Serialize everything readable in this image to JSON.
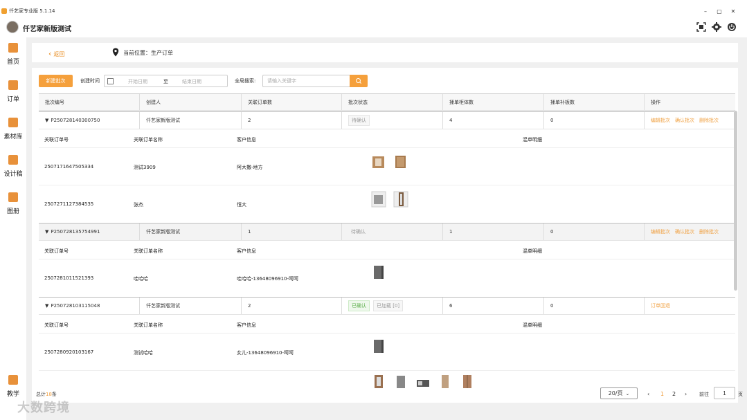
{
  "titlebar": {
    "app_title": "仟艺家专业版 5.1.14"
  },
  "header": {
    "user_name": "仟艺家新版测试"
  },
  "sidebar": {
    "items": [
      {
        "label": "首页",
        "icon": "home-icon"
      },
      {
        "label": "订单",
        "icon": "order-icon"
      },
      {
        "label": "素材库",
        "icon": "material-icon"
      },
      {
        "label": "设计稿",
        "icon": "design-icon"
      },
      {
        "label": "图册",
        "icon": "album-icon"
      }
    ],
    "bottom_item": {
      "label": "教学",
      "icon": "tutorial-icon"
    }
  },
  "breadcrumb": {
    "back": "返回",
    "location": "当前位置：生产订单"
  },
  "toolbar": {
    "new_batch": "新建批次",
    "created_time_label": "创建时间",
    "start_placeholder": "开始日期",
    "range_sep": "至",
    "end_placeholder": "结束日期",
    "search_label": "全局搜索:",
    "search_placeholder": "请输入关键字"
  },
  "table": {
    "columns": [
      "批次编号",
      "创建人",
      "关联订单数",
      "批次状态",
      "揉单柜体数",
      "揉单补板数",
      "操作"
    ],
    "sub_columns": [
      "关联订单号",
      "关联订单名称",
      "客户信息",
      "混单明细"
    ],
    "batches": [
      {
        "id": "P250728140300750",
        "creator": "仟艺家新版测试",
        "order_count": "2",
        "status": "待确认",
        "status2": "",
        "cabinet_count": "4",
        "board_count": "0",
        "actions": [
          "编辑批次",
          "确认批次",
          "删除批次"
        ],
        "orders": [
          {
            "no": "2507171647505334",
            "name": "测试3909",
            "customer": "阿大撒-地方"
          },
          {
            "no": "2507271127384535",
            "name": "张杰",
            "customer": "恒大"
          }
        ]
      },
      {
        "id": "P250728135754991",
        "creator": "仟艺家新版测试",
        "order_count": "1",
        "status": "待确认",
        "status2": "",
        "cabinet_count": "1",
        "board_count": "0",
        "actions": [
          "编辑批次",
          "确认批次",
          "删除批次"
        ],
        "orders": [
          {
            "no": "2507281011521393",
            "name": "哇哈哈",
            "customer": "哇哈哈-13648096910-呵呵"
          }
        ]
      },
      {
        "id": "P250728103115048",
        "creator": "仟艺家新版测试",
        "order_count": "2",
        "status": "已确认",
        "status2": "已加载 [0]",
        "cabinet_count": "6",
        "board_count": "0",
        "actions": [
          "订单回退"
        ],
        "orders": [
          {
            "no": "2507280920103167",
            "name": "测试哈哈",
            "customer": "女儿-13648096910-呵呵"
          }
        ]
      }
    ]
  },
  "footer": {
    "total_prefix": "总计",
    "total_count": "18",
    "total_suffix": "条",
    "page_size": "20/页",
    "pages": [
      "1",
      "2"
    ],
    "goto_label": "前往",
    "goto_value": "1",
    "goto_suffix": "页"
  },
  "watermark": "大数跨境",
  "colors": {
    "accent": "#f5a03c",
    "confirmed": "#5fb04e"
  }
}
